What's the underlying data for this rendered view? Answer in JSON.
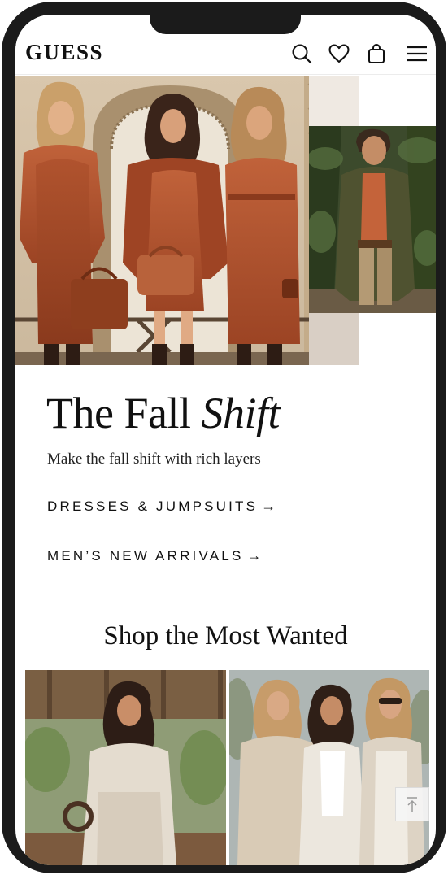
{
  "header": {
    "logo": "GUESS",
    "icons": [
      "search-icon",
      "heart-icon",
      "bag-icon",
      "menu-icon"
    ]
  },
  "hero": {
    "headline_plain": "The Fall ",
    "headline_italic": "Shift",
    "subline": "Make the fall shift with rich layers",
    "links": [
      {
        "label": "DRESSES & JUMPSUITS",
        "arrow": "→"
      },
      {
        "label": "MEN’S NEW ARRIVALS",
        "arrow": "→"
      }
    ]
  },
  "most_wanted": {
    "title": "Shop the Most Wanted"
  },
  "colors": {
    "frame": "#1b1b1b",
    "rust": "#b5552f",
    "olive": "#4d5034",
    "cream": "#e8dfd3"
  }
}
